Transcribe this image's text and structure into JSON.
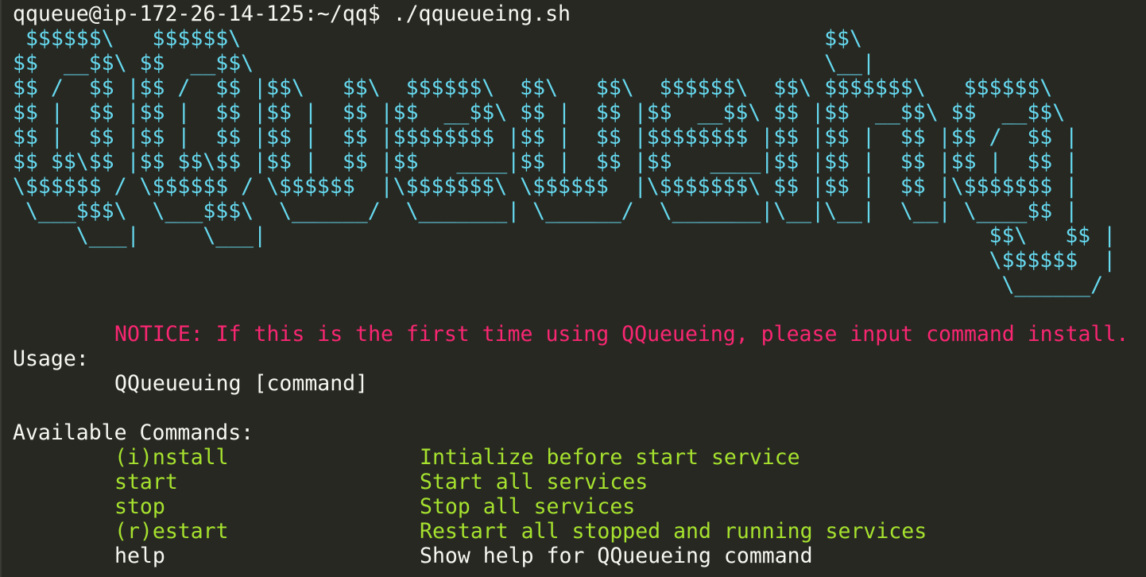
{
  "prompt": {
    "line": "qqueue@ip-172-26-14-125:~/qq$ ./qqueueing.sh"
  },
  "banner": [
    " $$$$$$\\   $$$$$$\\                                              $$\\",
    "$$  __$$\\ $$  __$$\\                                             \\__|",
    "$$ /  $$ |$$ /  $$ |$$\\   $$\\  $$$$$$\\  $$\\   $$\\  $$$$$$\\  $$\\ $$$$$$$\\   $$$$$$\\",
    "$$ |  $$ |$$ |  $$ |$$ |  $$ |$$  __$$\\ $$ |  $$ |$$  __$$\\ $$ |$$  __$$\\ $$  __$$\\",
    "$$ |  $$ |$$ |  $$ |$$ |  $$ |$$$$$$$$ |$$ |  $$ |$$$$$$$$ |$$ |$$ |  $$ |$$ /  $$ |",
    "$$ $$\\$$ |$$ $$\\$$ |$$ |  $$ |$$   ____|$$ |  $$ |$$   ____|$$ |$$ |  $$ |$$ |  $$ |",
    "\\$$$$$$ / \\$$$$$$ / \\$$$$$$  |\\$$$$$$$\\ \\$$$$$$  |\\$$$$$$$\\ $$ |$$ |  $$ |\\$$$$$$$ |",
    " \\___$$$\\  \\___$$$\\  \\______/  \\_______| \\______/  \\_______|\\__|\\__|  \\__| \\____$$ |",
    "     \\___|     \\___|                                                         $$\\   $$ |",
    "                                                                             \\$$$$$$  |",
    "                                                                              \\______/"
  ],
  "notice": "NOTICE: If this is the first time using QQueueing, please input command install.",
  "usage": {
    "heading": "Usage:",
    "syntax": "QQueueuing [command]"
  },
  "commands": {
    "heading": "Available Commands:",
    "items": [
      {
        "name": "(i)nstall",
        "description": "Intialize before start service",
        "color": "#a6e22e"
      },
      {
        "name": "start",
        "description": "Start all services",
        "color": "#a6e22e"
      },
      {
        "name": "stop",
        "description": "Stop all services",
        "color": "#a6e22e"
      },
      {
        "name": "(r)estart",
        "description": "Restart all stopped and running services",
        "color": "#a6e22e"
      },
      {
        "name": "help",
        "description": "Show help for QQueueing command",
        "color": "#f8f8f2"
      }
    ]
  },
  "colors": {
    "background": "#272822",
    "foreground": "#f8f8f2",
    "banner": "#66d9ef",
    "notice": "#f92672",
    "command": "#a6e22e"
  }
}
